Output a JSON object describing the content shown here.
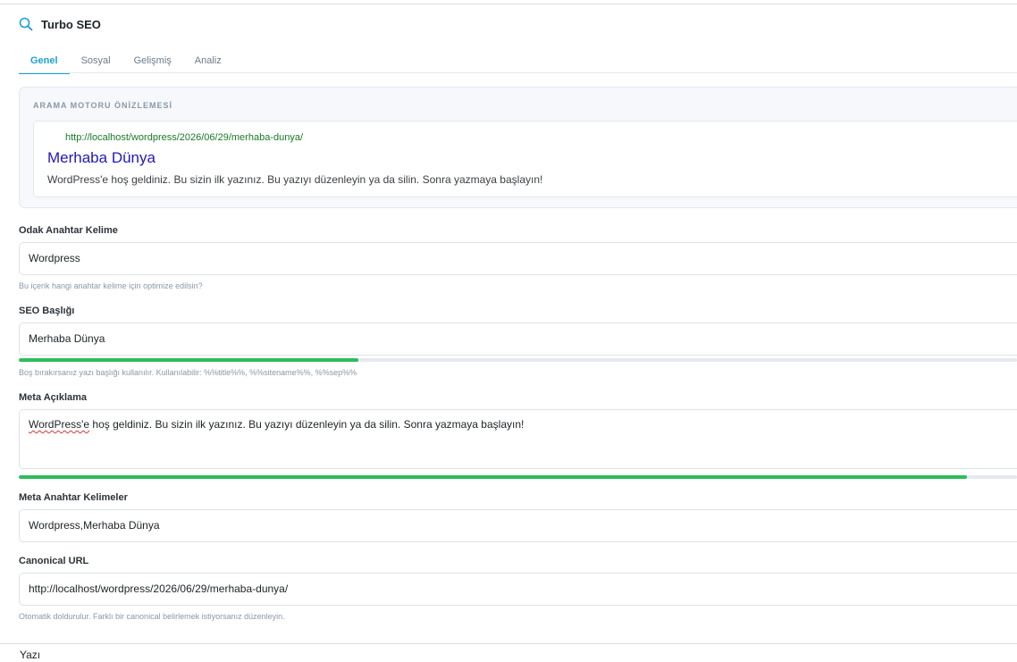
{
  "header": {
    "title": "Turbo SEO",
    "icon": "search-icon"
  },
  "tabs": [
    {
      "label": "Genel",
      "active": true
    },
    {
      "label": "Sosyal",
      "active": false
    },
    {
      "label": "Gelişmiş",
      "active": false
    },
    {
      "label": "Analiz",
      "active": false
    }
  ],
  "preview": {
    "section_label": "ARAMA MOTORU ÖNİZLEMESİ",
    "url": "http://localhost/wordpress/2026/06/29/merhaba-dunya/",
    "title": "Merhaba Dünya",
    "description": "WordPress'e hoş geldiniz. Bu sizin ilk yazınız. Bu yazıyı düzenleyin ya da silin. Sonra yazmaya başlayın!"
  },
  "focus_keyword": {
    "label": "Odak Anahtar Kelime",
    "value": "Wordpress",
    "hint": "Bu içerik hangi anahtar kelime için optimize edilsin?"
  },
  "seo_title": {
    "label": "SEO Başlığı",
    "value": "Merhaba Dünya",
    "progress": 0.34,
    "progress_color": "#2dbd5a",
    "hint": "Boş bırakırsanız yazı başlığı kullanılır. Kullanılabilir: %%title%%, %%sitename%%, %%sep%%"
  },
  "meta_description": {
    "label": "Meta Açıklama",
    "value_misspelled": "WordPress'e",
    "value_rest": " hoş geldiniz. Bu sizin ilk yazınız. Bu yazıyı düzenleyin ya da silin. Sonra yazmaya başlayın!",
    "progress": 0.95,
    "progress_color": "#2dbd5a"
  },
  "meta_keywords": {
    "label": "Meta Anahtar Kelimeler",
    "value": "Wordpress,Merhaba Dünya"
  },
  "canonical": {
    "label": "Canonical URL",
    "value": "http://localhost/wordpress/2026/06/29/merhaba-dunya/",
    "hint": "Otomatik doldurulur. Farklı bir canonical belirlemek istiyorsanız düzenleyin."
  },
  "footer": {
    "label": "Yazı"
  },
  "colors": {
    "accent": "#1e9fd6",
    "preview_title": "#2019b8",
    "preview_url": "#1a7a27"
  }
}
